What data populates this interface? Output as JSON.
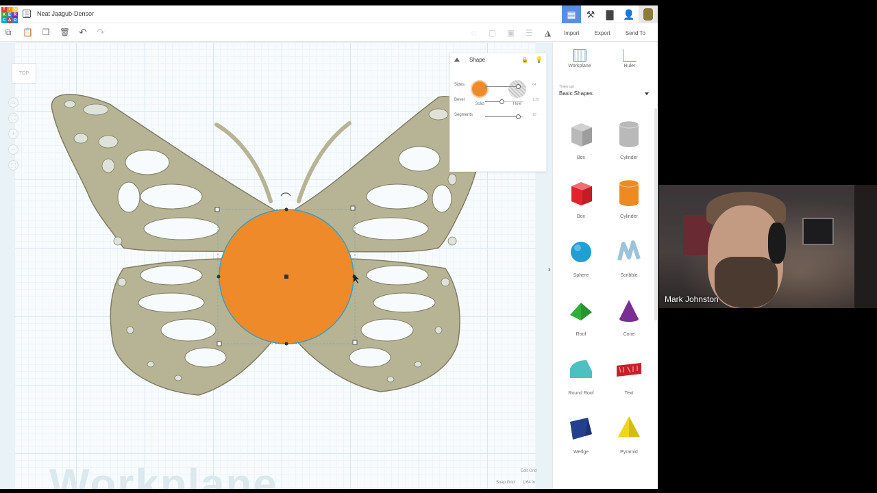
{
  "app": {
    "title": "Neat Jaagub-Densor",
    "logo_letters": [
      "T",
      "I",
      "N",
      "K",
      "E",
      "R",
      "C",
      "A",
      "D"
    ],
    "logo_colors": [
      "#e53935",
      "#ff8f00",
      "#fdd835",
      "#43a047",
      "#1e88e5",
      "#8e24aa",
      "#00acc1",
      "#e53935",
      "#1e88e5"
    ]
  },
  "topbar": {
    "right_buttons": [
      {
        "name": "grid-view-icon",
        "glyph": "▦",
        "active": true
      },
      {
        "name": "build-tools-icon",
        "glyph": "⚒",
        "active": false
      },
      {
        "name": "projects-icon",
        "glyph": "▇",
        "active": false
      },
      {
        "name": "add-user-icon",
        "glyph": "👤",
        "active": false
      }
    ]
  },
  "toolbar": {
    "copy_glyph": "⧉",
    "paste_glyph": "📋",
    "duplicate_glyph": "❐",
    "delete_glyph": "🗑",
    "undo_glyph": "↶",
    "redo_glyph": "↷",
    "import_label": "Import",
    "export_label": "Export",
    "send_label": "Send To"
  },
  "workplane": {
    "view_label": "TOP",
    "watermark": "Workplane",
    "edit_grid_label": "Edit Grid",
    "snap_grid_label": "Snap Grid",
    "snap_grid_value": "1/64 in",
    "nav_glyphs": [
      "⌂",
      "⛶",
      "+",
      "−",
      "⬚"
    ],
    "butterfly_color": "#b7b496",
    "circle_color": "#ee8a2a"
  },
  "shape_panel": {
    "title": "Shape",
    "solid_label": "Solid",
    "hole_label": "Hole",
    "sliders": [
      {
        "label": "Sides",
        "value": "64",
        "fraction": 0.85
      },
      {
        "label": "Bevel",
        "value": "1.25",
        "fraction": 0.42
      },
      {
        "label": "Segments",
        "value": "10",
        "fraction": 0.85
      }
    ]
  },
  "library": {
    "workplane_label": "Workplane",
    "ruler_label": "Ruler",
    "category_small": "Tinkercad",
    "category": "Basic Shapes",
    "shapes": [
      {
        "label": "Box",
        "name": "box-hole-shape",
        "kind": "box",
        "color": "#b9b9b9"
      },
      {
        "label": "Cylinder",
        "name": "cylinder-hole-shape",
        "kind": "cyl",
        "color": "#b9b9b9"
      },
      {
        "label": "Box",
        "name": "box-shape",
        "kind": "box",
        "color": "#e3232c"
      },
      {
        "label": "Cylinder",
        "name": "cylinder-shape",
        "kind": "cyl",
        "color": "#ee8a1f"
      },
      {
        "label": "Sphere",
        "name": "sphere-shape",
        "kind": "sphere",
        "color": "#1f9fd3"
      },
      {
        "label": "Scribble",
        "name": "scribble-shape",
        "kind": "scribble",
        "color": "#9cc3dc"
      },
      {
        "label": "Roof",
        "name": "roof-shape",
        "kind": "roof",
        "color": "#2fae38"
      },
      {
        "label": "Cone",
        "name": "cone-shape",
        "kind": "cone",
        "color": "#7b2d96"
      },
      {
        "label": "Round Roof",
        "name": "round-roof-shape",
        "kind": "rroof",
        "color": "#4cc1c0"
      },
      {
        "label": "Text",
        "name": "text-shape",
        "kind": "text",
        "color": "#c8202a"
      },
      {
        "label": "Wedge",
        "name": "wedge-shape",
        "kind": "wedge",
        "color": "#23408f"
      },
      {
        "label": "Pyramid",
        "name": "pyramid-shape",
        "kind": "pyramid",
        "color": "#f2d51a"
      }
    ]
  },
  "webcam": {
    "name": "Mark Johnston"
  }
}
